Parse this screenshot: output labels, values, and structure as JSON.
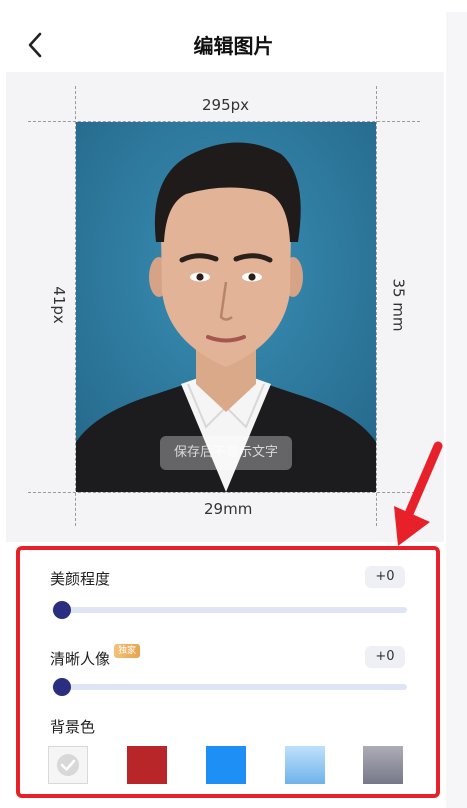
{
  "header": {
    "title": "编辑图片"
  },
  "photo_size": {
    "width_px": "295px",
    "height_px": "41px",
    "width_mm": "29mm",
    "height_mm": "35 mm"
  },
  "preview": {
    "watermark": "保存后不显示文字"
  },
  "adjustments": {
    "beauty": {
      "label": "美颜程度",
      "value": "+0",
      "level": 0
    },
    "clarity": {
      "label": "清晰人像",
      "tag": "独家",
      "value": "+0",
      "level": 0
    }
  },
  "background": {
    "label": "背景色",
    "selected_index": 0,
    "colors": [
      {
        "name": "none",
        "color": "#f2f2f2"
      },
      {
        "name": "red",
        "color": "#b8262a"
      },
      {
        "name": "blue",
        "color": "#1e90f5"
      },
      {
        "name": "light-blue-gradient",
        "color": "#8cc4ef"
      },
      {
        "name": "gray-gradient",
        "color": "#8d8f99"
      }
    ]
  },
  "colors": {
    "highlight_border": "#e8202a",
    "slider_thumb": "#2b2e7f",
    "slider_track": "#dfe5f5"
  }
}
